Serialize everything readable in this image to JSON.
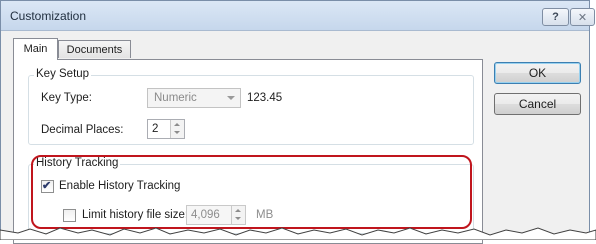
{
  "window": {
    "title": "Customization",
    "help_glyph": "?",
    "close_glyph": "✕"
  },
  "tabs": [
    {
      "label": "Main",
      "selected": true
    },
    {
      "label": "Documents",
      "selected": false
    }
  ],
  "key_setup": {
    "group_label": "Key Setup",
    "key_type_label": "Key Type:",
    "key_type_value": "Numeric",
    "key_type_sample": "123.45",
    "decimal_places_label": "Decimal Places:",
    "decimal_places_value": "2"
  },
  "history_tracking": {
    "group_label": "History Tracking",
    "enable_label": "Enable History Tracking",
    "enable_checked": true,
    "limit_label": "Limit history file size:",
    "limit_checked": false,
    "limit_value": "4,096",
    "limit_unit": "MB"
  },
  "buttons": {
    "ok": "OK",
    "cancel": "Cancel"
  },
  "colors": {
    "highlight": "#c0151d",
    "titlebar": "#c6d7ec"
  },
  "icons": {
    "checkmark": "✔"
  }
}
